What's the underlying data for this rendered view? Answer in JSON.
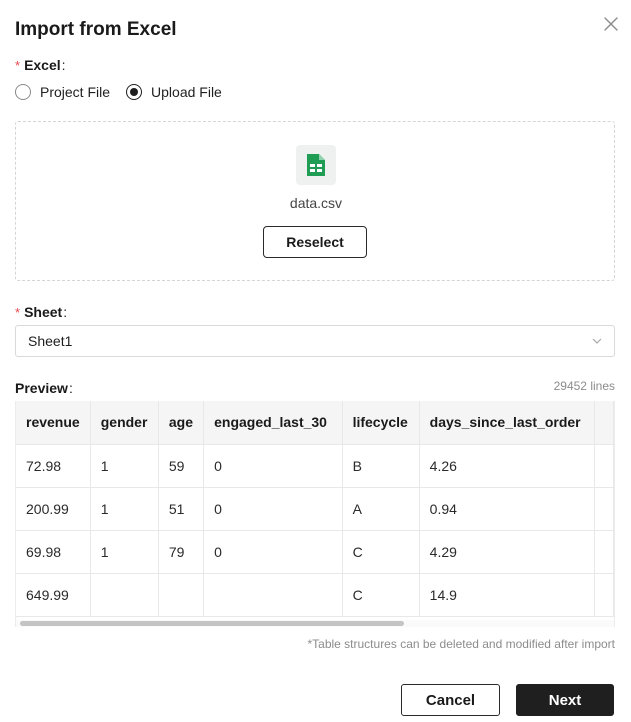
{
  "dialog": {
    "title": "Import from Excel",
    "close_icon": "close-icon"
  },
  "excel_field": {
    "required_mark": "*",
    "label": "Excel",
    "colon": ":",
    "options": [
      {
        "label": "Project File",
        "checked": false
      },
      {
        "label": "Upload File",
        "checked": true
      }
    ]
  },
  "upload": {
    "file_icon": "spreadsheet-icon",
    "file_icon_color": "#1f9d55",
    "file_name": "data.csv",
    "reselect_label": "Reselect"
  },
  "sheet_field": {
    "required_mark": "*",
    "label": "Sheet",
    "colon": ":",
    "selected": "Sheet1",
    "chevron_icon": "chevron-down-icon"
  },
  "preview": {
    "label": "Preview",
    "colon": ":",
    "lines_count": "29452 lines",
    "columns": [
      "revenue",
      "gender",
      "age",
      "engaged_last_30",
      "lifecycle",
      "days_since_last_order"
    ],
    "rows": [
      [
        "72.98",
        "1",
        "59",
        "0",
        "B",
        "4.26"
      ],
      [
        "200.99",
        "1",
        "51",
        "0",
        "A",
        "0.94"
      ],
      [
        "69.98",
        "1",
        "79",
        "0",
        "C",
        "4.29"
      ],
      [
        "649.99",
        "",
        "",
        "",
        "C",
        "14.9"
      ]
    ],
    "scroll_fraction": 0.64
  },
  "note": "*Table structures can be deleted and modified after import",
  "footer": {
    "cancel_label": "Cancel",
    "next_label": "Next"
  },
  "colors": {
    "required": "#e5484d",
    "primary_button": "#1f1f1f",
    "muted_text": "#8c8c8c"
  }
}
